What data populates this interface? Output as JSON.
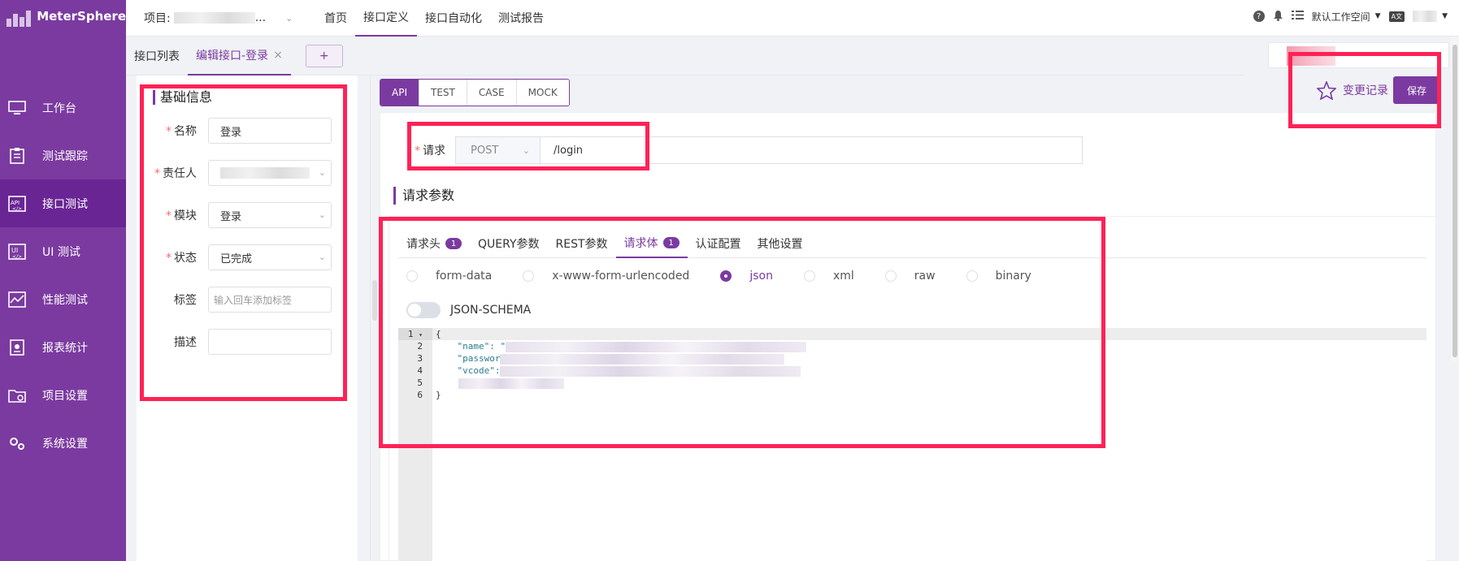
{
  "app": {
    "name": "MeterSphere"
  },
  "sidebar": {
    "items": [
      {
        "label": "工作台",
        "icon": "monitor-icon"
      },
      {
        "label": "测试跟踪",
        "icon": "clipboard-icon"
      },
      {
        "label": "接口测试",
        "icon": "api-icon",
        "active": true
      },
      {
        "label": "UI 测试",
        "icon": "ui-icon"
      },
      {
        "label": "性能测试",
        "icon": "performance-chart-icon"
      },
      {
        "label": "报表统计",
        "icon": "report-icon"
      },
      {
        "label": "项目设置",
        "icon": "folder-settings-icon"
      },
      {
        "label": "系统设置",
        "icon": "gears-icon"
      }
    ]
  },
  "header": {
    "project_label": "项目:",
    "project_ellipsis": "...",
    "nav": [
      "首页",
      "接口定义",
      "接口自动化",
      "测试报告"
    ],
    "active_nav": "接口定义",
    "workspace": "默认工作空间",
    "lang_icon": "translate-icon"
  },
  "tabs": {
    "items": [
      "接口列表",
      "编辑接口-登录"
    ],
    "active": "编辑接口-登录",
    "close": "×",
    "add": "+"
  },
  "basic_info": {
    "title": "基础信息",
    "fields": {
      "name_label": "名称",
      "name_value": "登录",
      "owner_label": "责任人",
      "module_label": "模块",
      "module_value": "登录",
      "status_label": "状态",
      "status_value": "已完成",
      "tags_label": "标签",
      "tags_placeholder": "输入回车添加标签",
      "desc_label": "描述"
    }
  },
  "mode_tabs": {
    "items": [
      "API",
      "TEST",
      "CASE",
      "MOCK"
    ],
    "active": "API"
  },
  "actions": {
    "history": "变更记录",
    "save": "保存"
  },
  "request": {
    "label": "请求",
    "method": "POST",
    "path": "/login"
  },
  "params": {
    "title": "请求参数",
    "tabs": [
      {
        "label": "请求头",
        "badge": "1"
      },
      {
        "label": "QUERY参数"
      },
      {
        "label": "REST参数"
      },
      {
        "label": "请求体",
        "badge": "1",
        "active": true
      },
      {
        "label": "认证配置"
      },
      {
        "label": "其他设置"
      }
    ],
    "body_types": [
      "form-data",
      "x-www-form-urlencoded",
      "json",
      "xml",
      "raw",
      "binary"
    ],
    "body_selected": "json",
    "json_schema_label": "JSON-SCHEMA",
    "json_schema_enabled": false
  },
  "editor": {
    "line_numbers": [
      "1",
      "2",
      "3",
      "4",
      "5",
      "6"
    ],
    "lines": [
      "{",
      "    \"name\": \"",
      "    \"passwor",
      "    \"vcode\":",
      "",
      "}"
    ]
  },
  "colors": {
    "accent": "#7b3aa0",
    "highlight": "#ff2256"
  }
}
